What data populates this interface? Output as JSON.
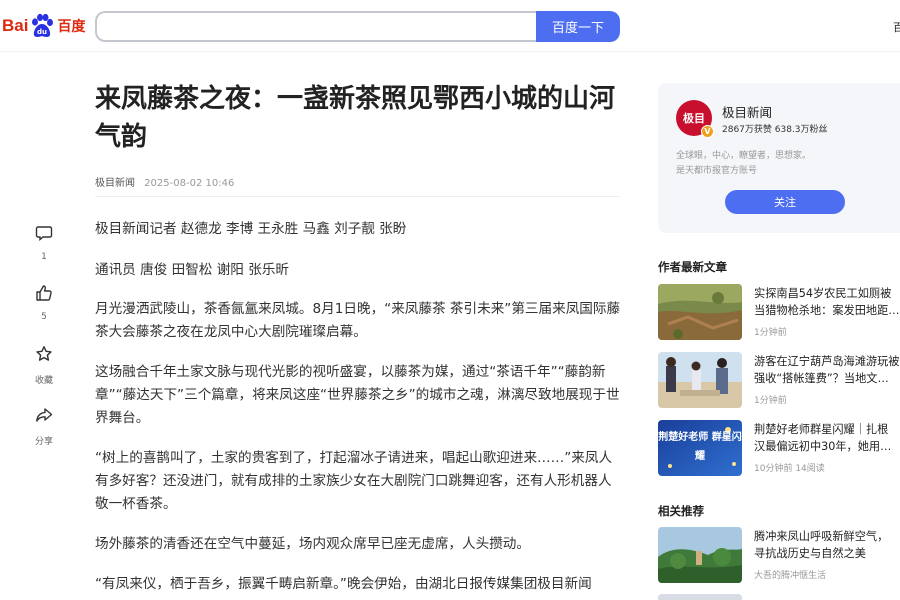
{
  "header": {
    "logo_bai": "Bai",
    "logo_du": "百度",
    "search_value": "",
    "search_button": "百度一下",
    "right_text": "百"
  },
  "article": {
    "title": "来凤藤茶之夜：一盏新茶照见鄂西小城的山河气韵",
    "source": "极目新闻",
    "time": "2025-08-02 10:46",
    "paragraphs": [
      "极目新闻记者 赵德龙 李博 王永胜 马鑫 刘子靓 张盼",
      "通讯员 唐俊 田智松 谢阳 张乐昕",
      "月光漫洒武陵山，茶香氤氲来凤城。8月1日晚，“来凤藤茶 茶引未来”第三届来凤国际藤茶大会藤茶之夜在龙凤中心大剧院璀璨启幕。",
      "这场融合千年土家文脉与现代光影的视听盛宴，以藤茶为媒，通过“茶语千年”“藤韵新章”“藤达天下”三个篇章，将来凤这座“世界藤茶之乡”的城市之魂，淋漓尽致地展现于世界舞台。",
      "“树上的喜鹊叫了，土家的贵客到了，打起溜冰子请进来，唱起山歌迎进来……”来凤人有多好客？还没进门，就有成排的土家族少女在大剧院门口跳舞迎客，还有人形机器人敬一杯香茶。",
      "场外藤茶的清香还在空气中蔓延，场内观众席早已座无虚席，人头攒动。",
      "“有凤来仪，栖于吾乡，振翼千畴启新章。”晚会伊始，由湖北日报传媒集团极目新闻"
    ]
  },
  "actions": [
    {
      "name": "comment",
      "label": "1"
    },
    {
      "name": "like",
      "label": "5"
    },
    {
      "name": "favorite",
      "label": "收藏"
    },
    {
      "name": "share",
      "label": "分享"
    }
  ],
  "author": {
    "avatar_text": "极目",
    "name": "极目新闻",
    "stats": "2867万获赞 638.3万粉丝",
    "desc_line1": "全球眼，中心，瞭望者，思想家。",
    "desc_line2": "是天都市报官方账号",
    "follow": "关注"
  },
  "latest": {
    "title": "作者最新文章",
    "items": [
      {
        "line1": "实探南昌54岁农民工如厕被",
        "line2": "当猎物枪杀地：案发田地距…",
        "meta": "1分钟前"
      },
      {
        "line1": "游客在辽宁葫芦岛海滩游玩被",
        "line2": "强收“搭帐篷费”？当地文…",
        "meta": "1分钟前"
      },
      {
        "line1": "荆楚好老师群星闪耀｜扎根",
        "line2": "汉最偏远初中30年，她用…",
        "meta": "10分钟前  14阅读"
      }
    ]
  },
  "related": {
    "title": "相关推荐",
    "items": [
      {
        "line1": "腾冲来凤山呼吸新鲜空气，",
        "line2": "寻抗战历史与自然之美",
        "meta": "大吾的腾冲惬生活"
      }
    ]
  },
  "thumb3_text": "荆楚好老师 群星闪耀",
  "colors": {
    "brand_blue": "#4e6ef2",
    "baidu_red": "#de2910",
    "avatar_red": "#c8102e"
  }
}
